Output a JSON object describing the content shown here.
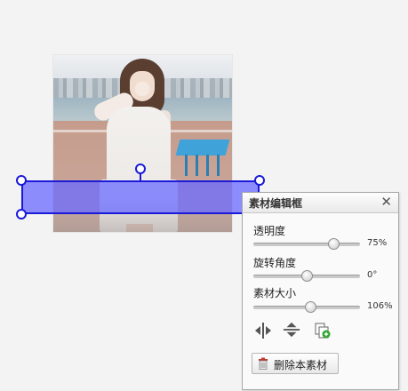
{
  "panel": {
    "title": "素材编辑框",
    "close_symbol": "✕",
    "opacity": {
      "label": "透明度",
      "value_text": "75%",
      "value": 0.75
    },
    "rotation": {
      "label": "旋转角度",
      "value_text": "0°",
      "value": 0.5
    },
    "size": {
      "label": "素材大小",
      "value_text": "106%",
      "value": 0.53
    },
    "tools": [
      "flip-horizontal-icon",
      "flip-vertical-icon",
      "copy-icon"
    ],
    "delete_button_label": "删除本素材"
  },
  "colors": {
    "material_fill": "#6a6aff",
    "selection": "#1a1ad8",
    "tool_green": "#2fa52f"
  }
}
